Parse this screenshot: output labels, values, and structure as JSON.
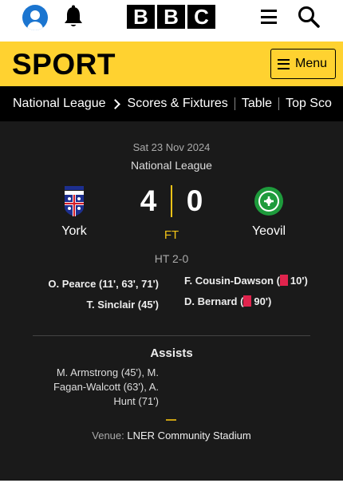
{
  "brand": {
    "logo_letters": [
      "B",
      "B",
      "C"
    ]
  },
  "sport": {
    "title": "SPORT",
    "menu_label": "Menu"
  },
  "nav": {
    "items": [
      "National League",
      "Scores & Fixtures",
      "Table",
      "Top Sco"
    ]
  },
  "match": {
    "date": "Sat 23 Nov 2024",
    "competition": "National League",
    "home": {
      "name": "York",
      "score": "4"
    },
    "away": {
      "name": "Yeovil",
      "score": "0"
    },
    "status": "FT",
    "half_time": "HT 2-0",
    "home_scorers": [
      "O. Pearce (11', 63', 71')",
      "T. Sinclair (45')"
    ],
    "away_events": [
      {
        "player": "F. Cousin-Dawson",
        "card": "red",
        "minute": "10'"
      },
      {
        "player": "D. Bernard",
        "card": "red",
        "minute": "90'"
      }
    ],
    "assists_heading": "Assists",
    "assists_text": "M. Armstrong (45'), M. Fagan-Walcott (63'), A. Hunt (71')",
    "venue_label": "Venue:",
    "venue_name": "LNER Community Stadium"
  },
  "colors": {
    "accent_yellow": "#ffd230",
    "score_divider": "#f2c317",
    "red_card": "#e0244d",
    "account_blue": "#1b75d0"
  },
  "icons": [
    "account-icon",
    "notifications-bell-icon",
    "hamburger-menu-icon",
    "search-icon",
    "chevron-right-icon",
    "red-card-icon"
  ]
}
